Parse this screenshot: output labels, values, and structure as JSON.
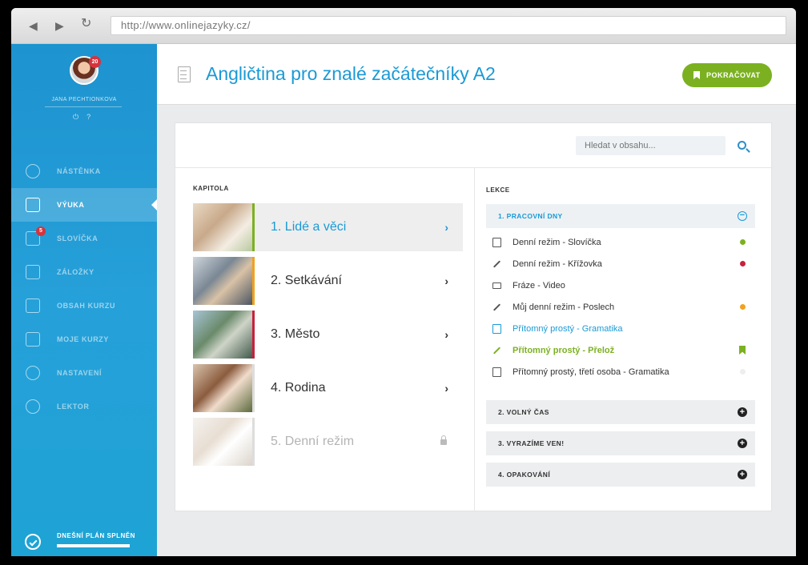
{
  "browser": {
    "url": "http://www.onlinejazyky.cz/"
  },
  "sidebar": {
    "user_name": "JANA PECHTIONKOVA",
    "avatar_badge": "20",
    "menu": [
      {
        "label": "NÁSTĚNKA",
        "icon": "dashboard-icon",
        "active": false,
        "badge": ""
      },
      {
        "label": "VÝUKA",
        "icon": "book-icon",
        "active": true,
        "badge": ""
      },
      {
        "label": "SLOVÍČKA",
        "icon": "vocabulary-icon",
        "active": false,
        "badge": "5"
      },
      {
        "label": "ZÁLOŽKY",
        "icon": "bookmark-icon",
        "active": false,
        "badge": ""
      },
      {
        "label": "OBSAH KURZU",
        "icon": "contents-icon",
        "active": false,
        "badge": ""
      },
      {
        "label": "MOJE KURZY",
        "icon": "courses-icon",
        "active": false,
        "badge": ""
      },
      {
        "label": "NASTAVENÍ",
        "icon": "gear-icon",
        "active": false,
        "badge": ""
      },
      {
        "label": "LEKTOR",
        "icon": "tutor-icon",
        "active": false,
        "badge": ""
      }
    ],
    "plan_label": "DNEŠNÍ PLÁN SPLNĚN",
    "plan_progress": 1.0
  },
  "header": {
    "title": "Angličtina pro znalé začátečníky A2",
    "continue_label": "POKRAČOVAT"
  },
  "search": {
    "placeholder": "Hledat v obsahu..."
  },
  "chapters_label": "KAPITOLA",
  "chapters": [
    {
      "title": "1. Lidé a věci",
      "state": "active",
      "stripe": "#7bb121"
    },
    {
      "title": "2. Setkávání",
      "state": "normal",
      "stripe": "#f0a21e"
    },
    {
      "title": "3. Město",
      "state": "normal",
      "stripe": "#c8213d"
    },
    {
      "title": "4. Rodina",
      "state": "normal",
      "stripe": "#dddddd"
    },
    {
      "title": "5. Denní režim",
      "state": "locked",
      "stripe": "#dddddd"
    }
  ],
  "lessons_label": "LEKCE",
  "units": [
    {
      "title": "1. PRACOVNÍ DNY",
      "open": true
    },
    {
      "title": "2. VOLNÝ ČAS",
      "open": false
    },
    {
      "title": "3. VYRAZÍME VEN!",
      "open": false
    },
    {
      "title": "4. OPAKOVÁNÍ",
      "open": false
    }
  ],
  "lessons": [
    {
      "label": "Denní režim - Slovíčka",
      "icon": "vocabulary-icon",
      "style": "normal",
      "status": "dot",
      "color": "#7bb121"
    },
    {
      "label": "Denní režim - Křížovka",
      "icon": "pencil-icon",
      "style": "normal",
      "status": "dot",
      "color": "#c8213d"
    },
    {
      "label": "Fráze - Video",
      "icon": "video-icon",
      "style": "normal",
      "status": "none",
      "color": ""
    },
    {
      "label": "Můj denní režim - Poslech",
      "icon": "pencil-icon",
      "style": "normal",
      "status": "dot",
      "color": "#f0a21e"
    },
    {
      "label": "Přítomný prostý - Gramatika",
      "icon": "document-icon",
      "style": "cyan",
      "status": "none",
      "color": ""
    },
    {
      "label": "Přítomný prostý - Přelož",
      "icon": "pencil-icon",
      "style": "green",
      "status": "bookmark",
      "color": "#7bb121"
    },
    {
      "label": "Přítomný prostý, třetí osoba - Gramatika",
      "icon": "document-icon",
      "style": "normal",
      "status": "dot",
      "color": "#eeeeee"
    }
  ]
}
